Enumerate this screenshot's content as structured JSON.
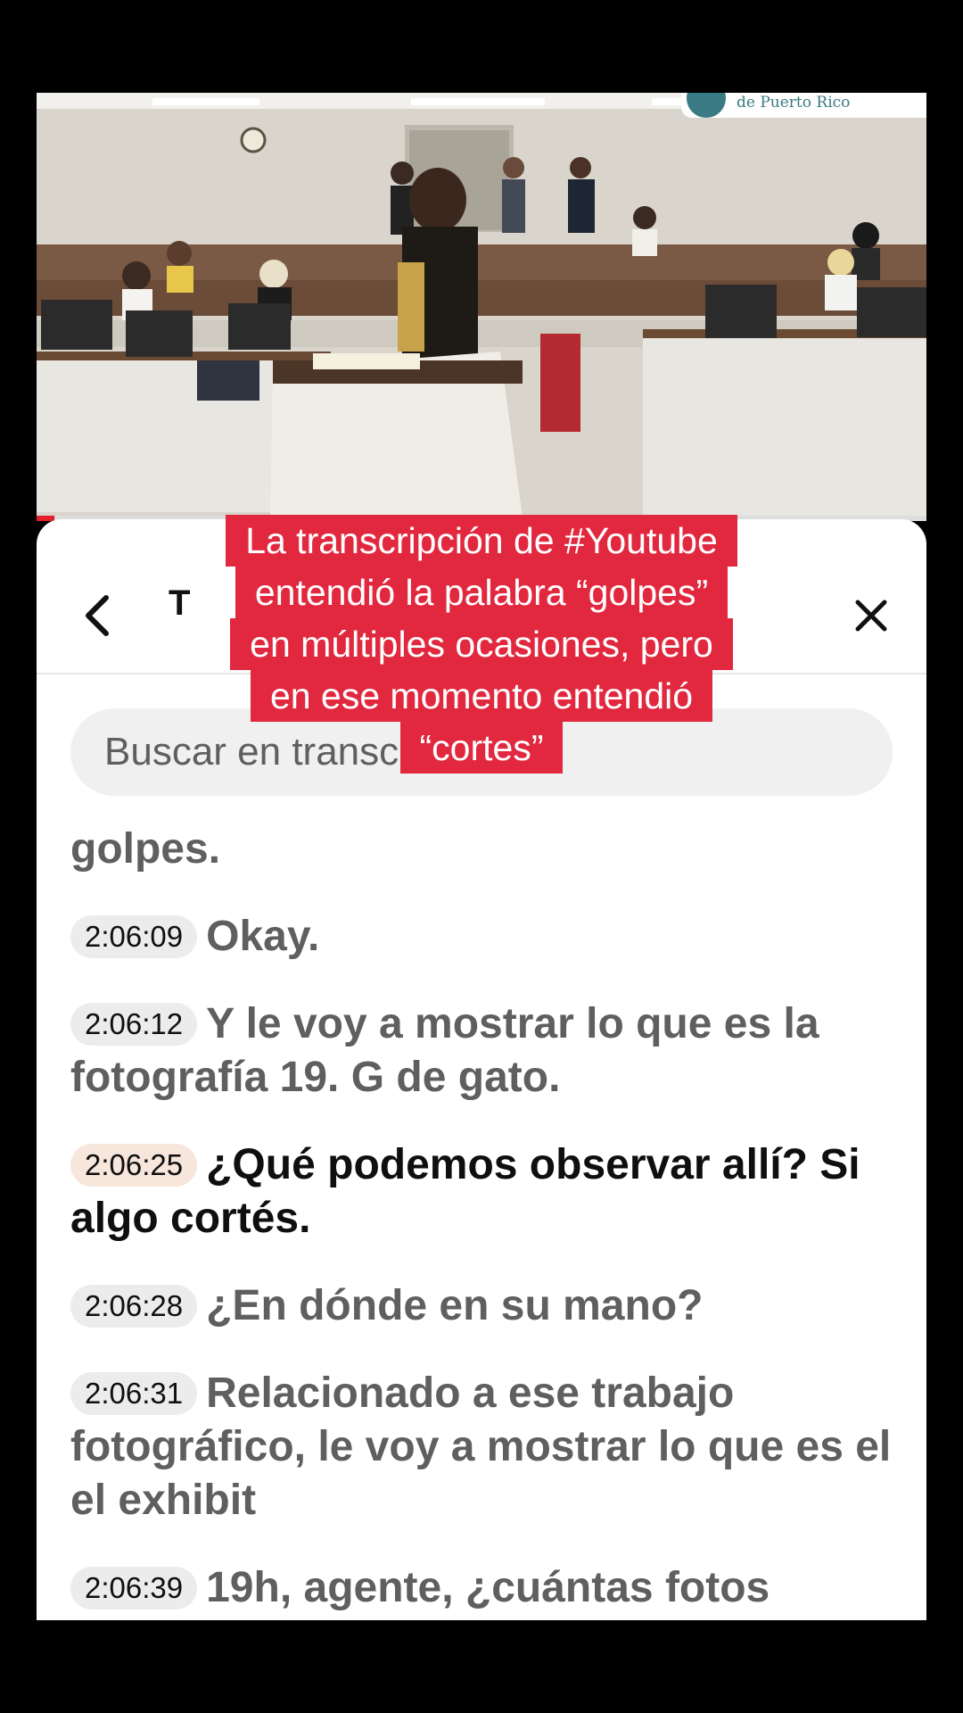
{
  "video": {
    "watermark_text": "de Puerto Rico",
    "progress_fraction": 0.02,
    "accent_color": "#e0202b"
  },
  "panel": {
    "title_fragment": "T",
    "back_icon": "chevron-left-icon",
    "close_icon": "close-icon"
  },
  "search": {
    "placeholder": "Buscar en transcripción"
  },
  "transcript": [
    {
      "time": "",
      "text": "golpes.",
      "active": false
    },
    {
      "time": "2:06:09",
      "text": "Okay.",
      "active": false
    },
    {
      "time": "2:06:12",
      "text": "Y le voy a mostrar lo que es la fotografía 19. G de gato.",
      "active": false
    },
    {
      "time": "2:06:25",
      "text": "¿Qué podemos observar allí? Si algo cortés.",
      "active": true
    },
    {
      "time": "2:06:28",
      "text": "¿En dónde en su mano?",
      "active": false
    },
    {
      "time": "2:06:31",
      "text": "Relacionado a ese trabajo fotográfico, le voy a mostrar lo que es el el exhibit",
      "active": false
    },
    {
      "time": "2:06:39",
      "text": "19h, agente, ¿cuántas fotos",
      "active": false
    }
  ],
  "caption": {
    "lines": [
      "La transcripción de #Youtube",
      "entendió la palabra “golpes”",
      "en múltiples ocasiones, pero",
      "en ese momento entendió",
      "“cortes”"
    ],
    "color": "#e2283f"
  }
}
